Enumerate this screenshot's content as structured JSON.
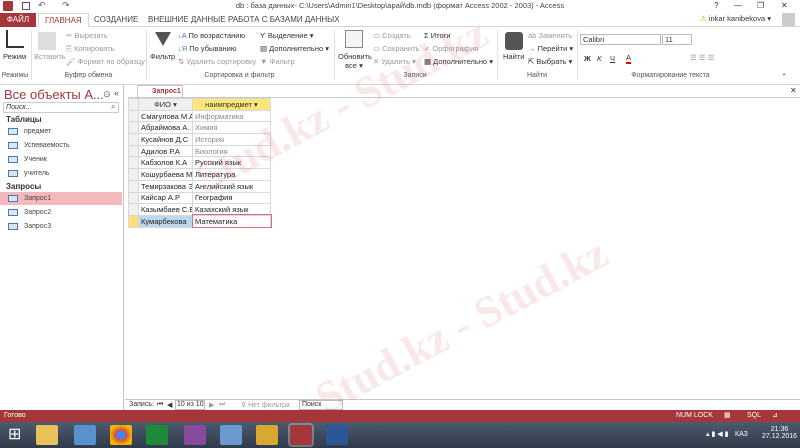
{
  "window": {
    "title": "db : база данных- C:\\Users\\Admin1\\Desktop\\арай\\db.mdb (формат Access 2002 - 2003) - Access",
    "help": "?",
    "minimize": "—",
    "restore": "❐",
    "close": "✕",
    "user": "inkar kanibekova"
  },
  "tabs": [
    "ФАЙЛ",
    "ГЛАВНАЯ",
    "СОЗДАНИЕ",
    "ВНЕШНИЕ ДАННЫЕ",
    "РАБОТА С БАЗАМИ ДАННЫХ"
  ],
  "ribbon": {
    "modes": {
      "view": "Режим",
      "group": "Режимы"
    },
    "clipboard": {
      "paste": "Вставить",
      "cut": "Вырезать",
      "copy": "Копировать",
      "format_painter": "Формат по образцу",
      "group": "Буфер обмена"
    },
    "sort": {
      "filter": "Фильтр",
      "asc": "По возрастанию",
      "desc": "По убыванию",
      "remove": "Удалить сортировку",
      "selection": "Выделение",
      "advanced": "Дополнительно",
      "toggle": "Фильтр",
      "group": "Сортировка и фильтр"
    },
    "records": {
      "refresh": "Обновить",
      "refresh2": "все",
      "new": "Создать",
      "save": "Сохранить",
      "delete": "Удалить",
      "totals": "Итоги",
      "spelling": "Орфография",
      "more": "Дополнительно",
      "group": "Записи"
    },
    "find": {
      "find": "Найти",
      "replace": "Заменить",
      "goto": "Перейти",
      "select": "Выбрать",
      "group": "Найти"
    },
    "text": {
      "font": "Calibri",
      "size": "11",
      "bold": "Ж",
      "italic": "К",
      "underline": "Ч",
      "group": "Форматирование текста"
    }
  },
  "nav": {
    "title": "Все объекты A...",
    "search_placeholder": "Поиск...",
    "tables_header": "Таблицы",
    "tables": [
      "предмет",
      "Успеваемость",
      "Ученик",
      "учитель"
    ],
    "queries_header": "Запросы",
    "queries": [
      "Запрос1",
      "Запрос2",
      "Запрос3"
    ]
  },
  "doc": {
    "tab": "Запрос1",
    "columns": [
      "ФИО",
      "наимпредмет"
    ],
    "rows": [
      [
        "Смагулова М.А",
        "Информатика"
      ],
      [
        "Абраймова А.",
        "Химия"
      ],
      [
        "Кусайнов Д.С",
        "История"
      ],
      [
        "Адилов Р.А",
        "Биология"
      ],
      [
        "Кабзолов К.А",
        "Русский язык"
      ],
      [
        "Кошурбаева М",
        "Литература"
      ],
      [
        "Темирзакова Э",
        "Английский язык"
      ],
      [
        "Кайсар А.Р",
        "География"
      ],
      [
        "Казымбаев С.Е",
        "Казахский язык"
      ],
      [
        "Кумарбекова",
        "Математика"
      ]
    ]
  },
  "recnav": {
    "label": "Запись:",
    "position": "10 из 10",
    "filter": "Нет фильтра",
    "search": "Поиск"
  },
  "status": {
    "left": "Готово",
    "numlock": "NUM LOCK"
  },
  "taskbar": {
    "lang": "КАЗ",
    "time": "21:36",
    "date": "27.12.2016"
  },
  "watermark": "Stud.kz"
}
